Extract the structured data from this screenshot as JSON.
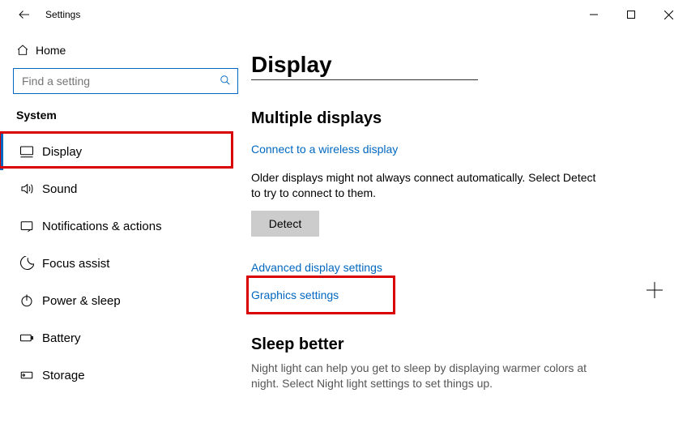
{
  "app": {
    "title": "Settings"
  },
  "sidebar": {
    "home_label": "Home",
    "search_placeholder": "Find a setting",
    "category": "System",
    "items": [
      {
        "label": "Display"
      },
      {
        "label": "Sound"
      },
      {
        "label": "Notifications & actions"
      },
      {
        "label": "Focus assist"
      },
      {
        "label": "Power & sleep"
      },
      {
        "label": "Battery"
      },
      {
        "label": "Storage"
      }
    ]
  },
  "page": {
    "title": "Display",
    "multiple_displays": {
      "heading": "Multiple displays",
      "wireless_link": "Connect to a wireless display",
      "detect_desc": "Older displays might not always connect automatically. Select Detect to try to connect to them.",
      "detect_button": "Detect",
      "advanced_link": "Advanced display settings",
      "graphics_link": "Graphics settings"
    },
    "sleep_better": {
      "heading": "Sleep better",
      "desc": "Night light can help you get to sleep by displaying warmer colors at night. Select Night light settings to set things up."
    }
  }
}
